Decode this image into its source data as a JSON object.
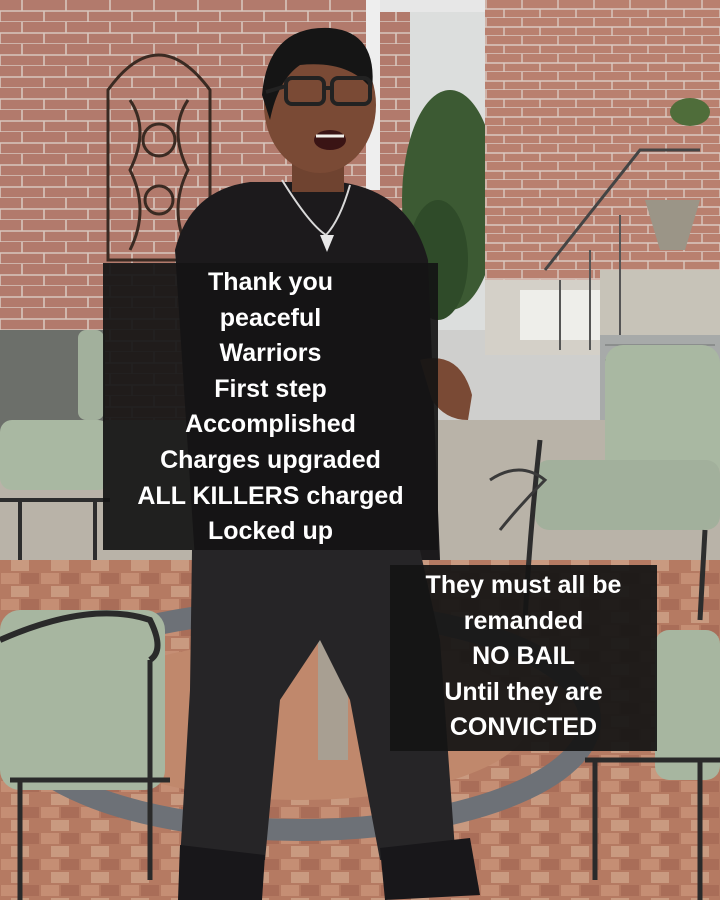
{
  "captions": {
    "primary": {
      "lines": [
        "Thank you",
        "peaceful",
        "Warriors",
        "First step",
        "Accomplished",
        "Charges upgraded",
        "ALL KILLERS charged",
        "Locked up"
      ]
    },
    "secondary": {
      "lines": [
        "They must all be",
        "remanded",
        "NO BAIL",
        "Until they are",
        "CONVICTED"
      ]
    }
  },
  "colors": {
    "caption_background": "#141414",
    "caption_text": "#ffffff",
    "brick": "#b27a6c",
    "cushion": "#a9b8a2",
    "patio_paver": "#b57a62"
  }
}
